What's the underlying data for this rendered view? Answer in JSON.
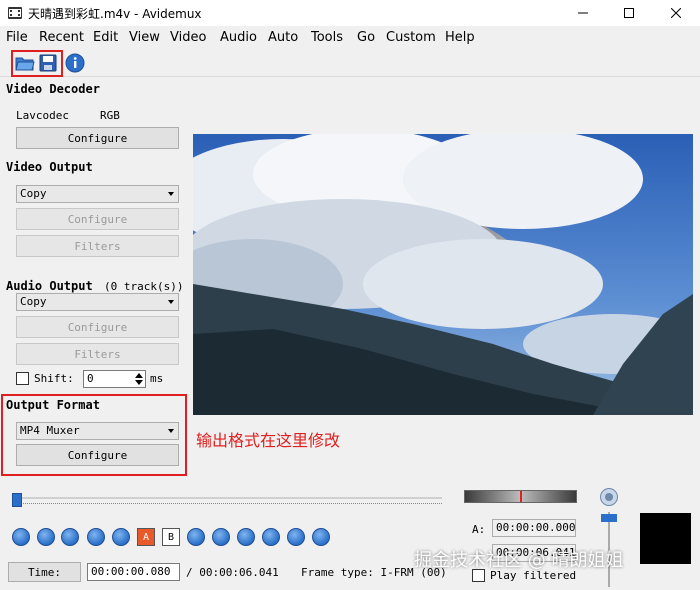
{
  "window": {
    "title": "天晴遇到彩虹.m4v - Avidemux"
  },
  "menu": [
    "File",
    "Recent",
    "Edit",
    "View",
    "Video",
    "Audio",
    "Auto",
    "Tools",
    "Go",
    "Custom",
    "Help"
  ],
  "toolbar": {
    "icons": [
      "open-folder-icon",
      "save-icon",
      "info-icon"
    ]
  },
  "video_decoder": {
    "title": "Video Decoder",
    "codec": "Lavcodec",
    "colorspace": "RGB",
    "configure_label": "Configure"
  },
  "video_output": {
    "title": "Video Output",
    "codec": "Copy",
    "configure_label": "Configure",
    "filters_label": "Filters"
  },
  "audio_output": {
    "title": "Audio Output",
    "tracks": "(0 track(s))",
    "codec": "Copy",
    "configure_label": "Configure",
    "filters_label": "Filters",
    "shift_label": "Shift:",
    "shift_value": "0",
    "shift_unit": "ms"
  },
  "output_format": {
    "title": "Output Format",
    "muxer": "MP4 Muxer",
    "configure_label": "Configure"
  },
  "annotation": "输出格式在这里修改",
  "timing": {
    "time_button": "Time:",
    "current": "00:00:00.080",
    "total": "/ 00:00:06.041",
    "frame_type": "Frame type: I-FRM (00)",
    "a_label": "A:",
    "a_value": "00:00:00.000",
    "b_label": "B:",
    "b_value": "00:00:06.041",
    "play_filtered": "Play filtered"
  },
  "watermark": "掘金技术社区 @ 晴朗姐姐",
  "colors": {
    "highlight": "#e02020",
    "accent": "#2a6fc9"
  }
}
